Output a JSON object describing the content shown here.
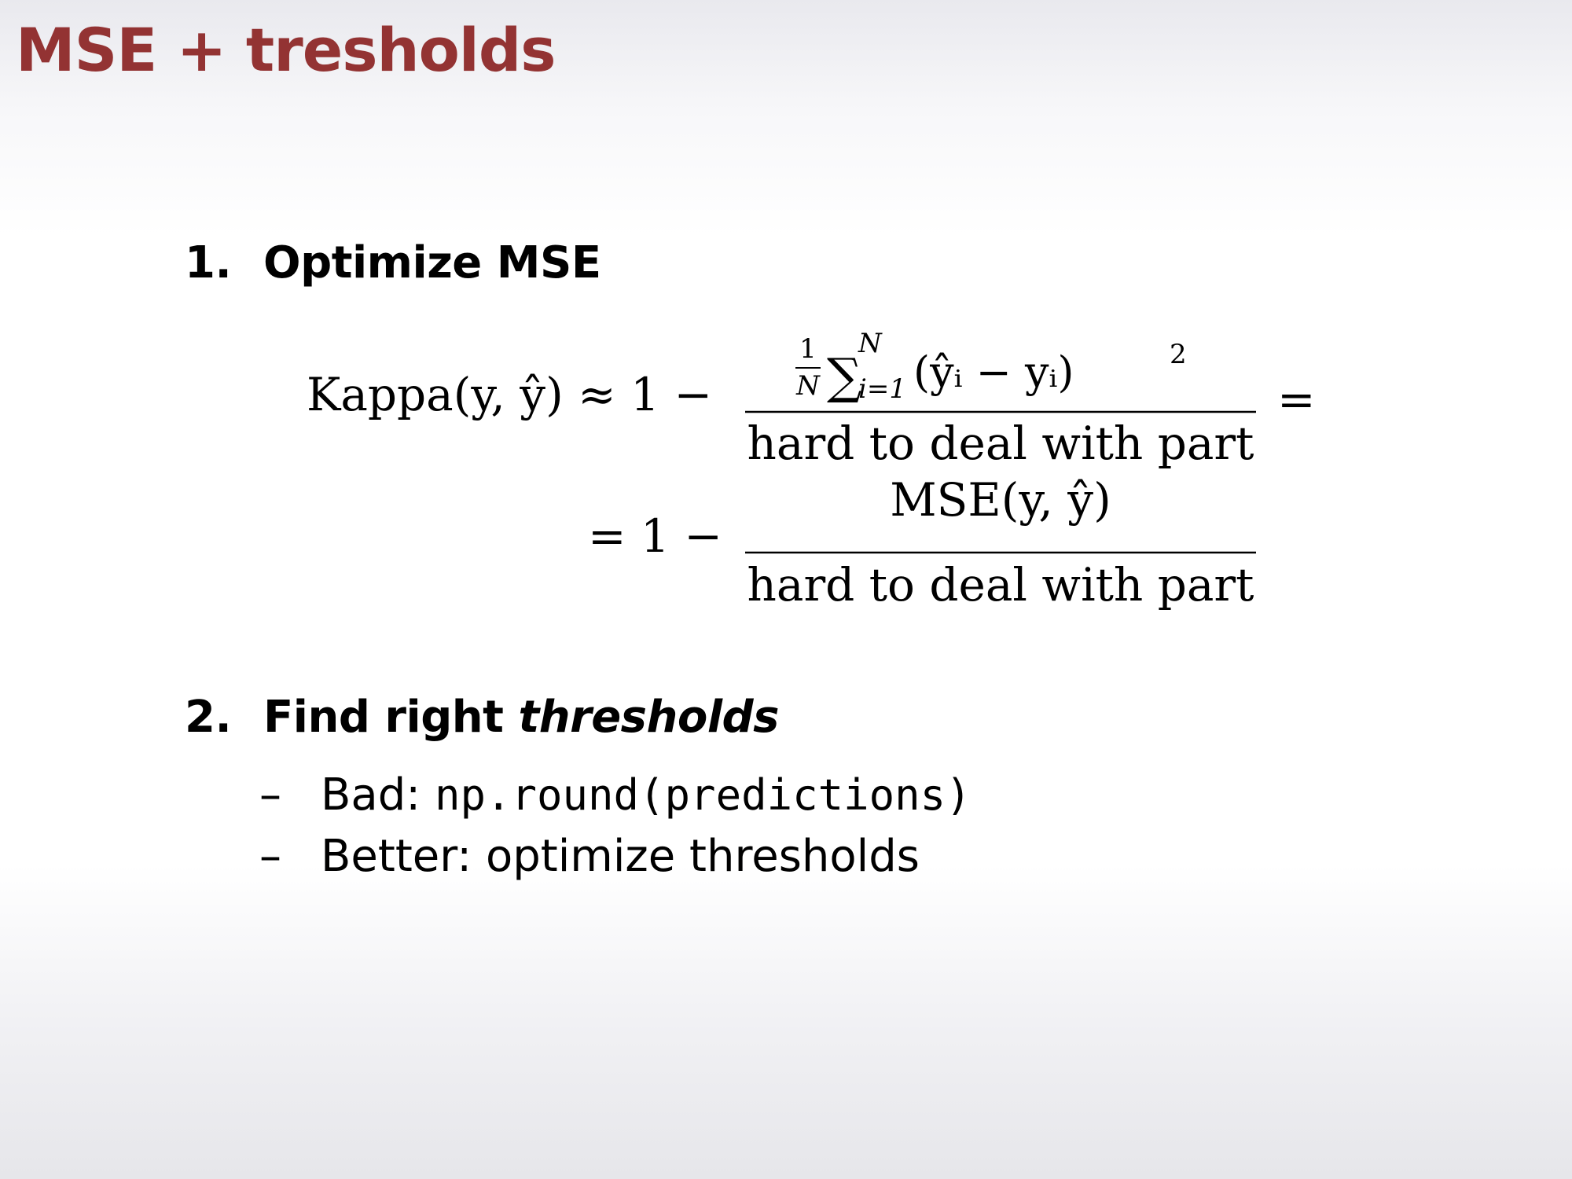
{
  "slide": {
    "title": "MSE + tresholds"
  },
  "sections": [
    {
      "number": "1.",
      "label": "Optimize MSE"
    },
    {
      "number": "2.",
      "label_plain": "Find right ",
      "label_italic": "thresholds"
    }
  ],
  "formula": {
    "line1_lhs": "Kappa(y, ŷ) ≈ 1 −",
    "line1_numerator_frac_num": "1",
    "line1_numerator_frac_den": "N",
    "line1_numerator_sum": "∑",
    "line1_numerator_sum_upper": "N",
    "line1_numerator_sum_lower": "i=1",
    "line1_numerator_body": "(ŷᵢ − yᵢ)",
    "line1_numerator_exp": "2",
    "line1_denominator": "hard to deal with part",
    "line1_rhs": "=",
    "line2_lhs": "= 1 −",
    "line2_numerator": "MSE(y, ŷ)",
    "line2_denominator": "hard to deal with part"
  },
  "bullets": [
    {
      "dash": "–",
      "label": "Bad: ",
      "code": "np.round(predictions)"
    },
    {
      "dash": "–",
      "label": "Better: optimize thresholds"
    }
  ],
  "colors": {
    "title": "#933333",
    "text": "#000000"
  }
}
